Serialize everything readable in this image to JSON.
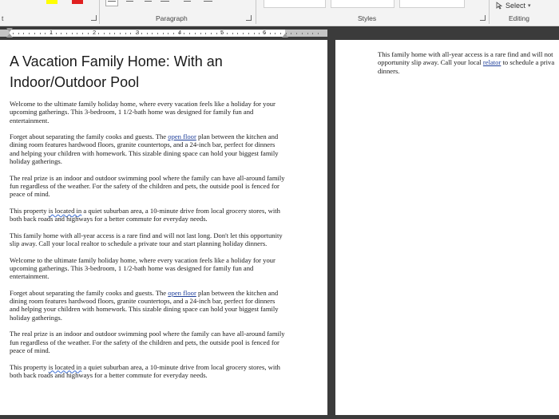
{
  "ribbon": {
    "partial_label": "t",
    "paragraph_label": "Paragraph",
    "styles_label": "Styles",
    "select_label": "Select",
    "editing_label": "Editing"
  },
  "ruler": {
    "numbers": [
      "1",
      "2",
      "3",
      "4",
      "5",
      "6"
    ]
  },
  "document": {
    "title": "A Vacation Family Home: With an Indoor/Outdoor Pool",
    "paragraphs": [
      {
        "type": "welcome",
        "text": "Welcome to the ultimate family holiday home, where every vacation feels like a holiday for your upcoming gatherings. This 3-bedroom, 1 1/2-bath home was designed for family fun and entertainment."
      },
      {
        "type": "floor",
        "before": "Forget about separating the family cooks and guests. The ",
        "link": "open floor",
        "after": " plan between the kitchen and dining room features hardwood floors, granite countertops, and a 24-inch bar, perfect for dinners and helping your children with homework. This sizable dining space can hold your biggest family holiday gatherings."
      },
      {
        "type": "pool",
        "text": "The real prize is an indoor and outdoor swimming pool where the family can have all-around family fun regardless of the weather. For the safety of the children and pets, the outside pool is fenced for peace of mind."
      },
      {
        "type": "location",
        "before": "This property ",
        "squiggle": "is located in",
        "after": " a quiet suburban area, a 10-minute drive from local grocery stores, with both back roads and highways for a better commute for everyday needs."
      },
      {
        "type": "access",
        "text": "This family home with all-year access is a rare find and will not last long. Don't let this opportunity slip away. Call your local realtor to schedule a private tour and start planning holiday dinners."
      },
      {
        "type": "welcome",
        "text": "Welcome to the ultimate family holiday home, where every vacation feels like a holiday for your upcoming gatherings. This 3-bedroom, 1 1/2-bath home was designed for family fun and entertainment."
      },
      {
        "type": "floor",
        "before": "Forget about separating the family cooks and guests. The ",
        "link": "open floor",
        "after": " plan between the kitchen and dining room features hardwood floors, granite countertops, and a 24-inch bar, perfect for dinners and helping your children with homework. This sizable dining space can hold your biggest family holiday gatherings."
      },
      {
        "type": "pool",
        "text": "The real prize is an indoor and outdoor swimming pool where the family can have all-around family fun regardless of the weather. For the safety of the children and pets, the outside pool is fenced for peace of mind."
      },
      {
        "type": "location",
        "before": "This property ",
        "squiggle": "is located in",
        "after": " a quiet suburban area, a 10-minute drive from local grocery stores, with both back roads and highways for a better commute for everyday needs."
      }
    ],
    "right_page": {
      "before": "This family home with all-year access is a rare find and will not opportunity slip away. Call your local ",
      "link": "relator",
      "after": " to schedule a priva dinners."
    }
  },
  "colors": {
    "highlight_yellow": "#ffff00",
    "font_red": "#e02020",
    "link_blue": "#1f3f9a",
    "canvas_gray": "#3b3b3b"
  }
}
